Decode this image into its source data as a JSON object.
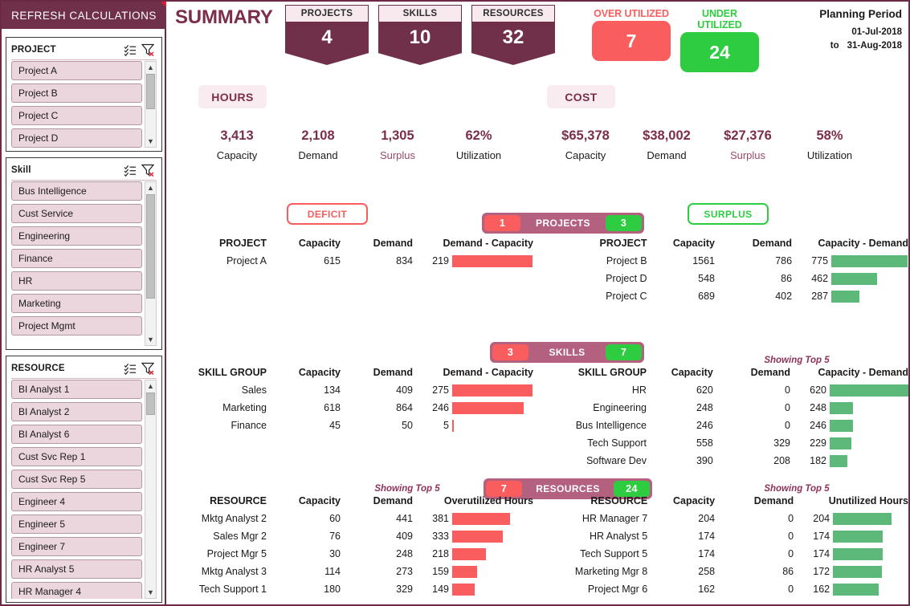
{
  "sidebar": {
    "refresh_label": "REFRESH CALCULATIONS",
    "slicers": [
      {
        "title": "PROJECT",
        "multiselect_icon": "multi-select-icon",
        "clear_filter_icon": "clear-filter-icon",
        "items": [
          "Project A",
          "Project B",
          "Project C",
          "Project D"
        ]
      },
      {
        "title": "Skill",
        "multiselect_icon": "multi-select-icon",
        "clear_filter_icon": "clear-filter-icon",
        "items": [
          "Bus Intelligence",
          "Cust Service",
          "Engineering",
          "Finance",
          "HR",
          "Marketing",
          "Project Mgmt"
        ]
      },
      {
        "title": "RESOURCE",
        "multiselect_icon": "multi-select-icon",
        "clear_filter_icon": "clear-filter-icon",
        "items": [
          "BI Analyst 1",
          "BI Analyst 2",
          "BI Analyst 6",
          "Cust Svc Rep 1",
          "Cust Svc Rep 5",
          "Engineer 4",
          "Engineer 5",
          "Engineer 7",
          "HR Analyst 5",
          "HR Manager 4"
        ]
      }
    ]
  },
  "header": {
    "title": "SUMMARY",
    "kpis": [
      {
        "label": "PROJECTS",
        "value": "4"
      },
      {
        "label": "SKILLS",
        "value": "10"
      },
      {
        "label": "RESOURCES",
        "value": "32"
      }
    ],
    "utilization_cards": [
      {
        "label": "OVER UTILIZED",
        "value": "7",
        "color": "#fa5d5d"
      },
      {
        "label": "UNDER UTILIZED",
        "value": "24",
        "color": "#2ecc40"
      }
    ],
    "planning_period": {
      "title": "Planning Period",
      "from": "01-Jul-2018",
      "to_label": "to",
      "to": "31-Aug-2018"
    }
  },
  "metrics": {
    "hours": {
      "tag": "HOURS",
      "items": [
        {
          "value": "3,413",
          "name": "Capacity",
          "accent": false
        },
        {
          "value": "2,108",
          "name": "Demand",
          "accent": false
        },
        {
          "value": "1,305",
          "name": "Surplus",
          "accent": true
        },
        {
          "value": "62%",
          "name": "Utilization",
          "accent": false
        }
      ]
    },
    "cost": {
      "tag": "COST",
      "items": [
        {
          "value": "$65,378",
          "name": "Capacity",
          "accent": false
        },
        {
          "value": "$38,002",
          "name": "Demand",
          "accent": false
        },
        {
          "value": "$27,376",
          "name": "Surplus",
          "accent": true
        },
        {
          "value": "58%",
          "name": "Utilization",
          "accent": false
        }
      ]
    }
  },
  "buttons": {
    "deficit": "DEFICIT",
    "surplus": "SURPLUS"
  },
  "showing_top": "Showing Top 5",
  "sections": {
    "projects": {
      "pill_label": "PROJECTS",
      "deficit_count": "1",
      "surplus_count": "3",
      "deficit_table": {
        "headers": [
          "PROJECT",
          "Capacity",
          "Demand",
          "Demand - Capacity"
        ],
        "rows": [
          {
            "name": "Project A",
            "capacity": "615",
            "demand": "834",
            "diff": "219",
            "bar_pct": 100
          }
        ]
      },
      "surplus_table": {
        "headers": [
          "PROJECT",
          "Capacity",
          "Demand",
          "Capacity - Demand"
        ],
        "rows": [
          {
            "name": "Project B",
            "capacity": "1561",
            "demand": "786",
            "diff": "775",
            "bar_pct": 100
          },
          {
            "name": "Project D",
            "capacity": "548",
            "demand": "86",
            "diff": "462",
            "bar_pct": 60
          },
          {
            "name": "Project C",
            "capacity": "689",
            "demand": "402",
            "diff": "287",
            "bar_pct": 37
          }
        ]
      }
    },
    "skills": {
      "pill_label": "SKILLS",
      "deficit_count": "3",
      "surplus_count": "7",
      "deficit_table": {
        "headers": [
          "SKILL GROUP",
          "Capacity",
          "Demand",
          "Demand - Capacity"
        ],
        "rows": [
          {
            "name": "Sales",
            "capacity": "134",
            "demand": "409",
            "diff": "275",
            "bar_pct": 100
          },
          {
            "name": "Marketing",
            "capacity": "618",
            "demand": "864",
            "diff": "246",
            "bar_pct": 89
          },
          {
            "name": "Finance",
            "capacity": "45",
            "demand": "50",
            "diff": "5",
            "bar_pct": 2
          }
        ]
      },
      "surplus_table": {
        "headers": [
          "SKILL GROUP",
          "Capacity",
          "Demand",
          "Capacity - Demand"
        ],
        "rows": [
          {
            "name": "HR",
            "capacity": "620",
            "demand": "0",
            "diff": "620",
            "bar_pct": 100
          },
          {
            "name": "Engineering",
            "capacity": "248",
            "demand": "0",
            "diff": "248",
            "bar_pct": 40
          },
          {
            "name": "Bus Intelligence",
            "capacity": "246",
            "demand": "0",
            "diff": "246",
            "bar_pct": 40
          },
          {
            "name": "Tech Support",
            "capacity": "558",
            "demand": "329",
            "diff": "229",
            "bar_pct": 37
          },
          {
            "name": "Software Dev",
            "capacity": "390",
            "demand": "208",
            "diff": "182",
            "bar_pct": 29
          }
        ]
      }
    },
    "resources": {
      "pill_label": "RESOURCES",
      "deficit_count": "7",
      "surplus_count": "24",
      "deficit_table": {
        "headers": [
          "RESOURCE",
          "Capacity",
          "Demand",
          "Overutilized Hours"
        ],
        "rows": [
          {
            "name": "Mktg Analyst 2",
            "capacity": "60",
            "demand": "441",
            "diff": "381",
            "bar_pct": 100
          },
          {
            "name": "Sales Mgr 2",
            "capacity": "76",
            "demand": "409",
            "diff": "333",
            "bar_pct": 87
          },
          {
            "name": "Project Mgr 5",
            "capacity": "30",
            "demand": "248",
            "diff": "218",
            "bar_pct": 57
          },
          {
            "name": "Mktg Analyst 3",
            "capacity": "114",
            "demand": "273",
            "diff": "159",
            "bar_pct": 42
          },
          {
            "name": "Tech Support 1",
            "capacity": "180",
            "demand": "329",
            "diff": "149",
            "bar_pct": 39
          }
        ]
      },
      "surplus_table": {
        "headers": [
          "RESOURCE",
          "Capacity",
          "Demand",
          "Unutilized Hours"
        ],
        "rows": [
          {
            "name": "HR Manager 7",
            "capacity": "204",
            "demand": "0",
            "diff": "204",
            "bar_pct": 100
          },
          {
            "name": "HR Analyst 5",
            "capacity": "174",
            "demand": "0",
            "diff": "174",
            "bar_pct": 85
          },
          {
            "name": "Tech Support 5",
            "capacity": "174",
            "demand": "0",
            "diff": "174",
            "bar_pct": 85
          },
          {
            "name": "Marketing Mgr 8",
            "capacity": "258",
            "demand": "86",
            "diff": "172",
            "bar_pct": 84
          },
          {
            "name": "Project Mgr 6",
            "capacity": "162",
            "demand": "0",
            "diff": "162",
            "bar_pct": 79
          }
        ]
      }
    }
  },
  "colors": {
    "brand": "#703049",
    "brand_light": "#b4607f",
    "deficit": "#fa5d5d",
    "surplus_badge": "#2ecc40",
    "surplus_bar": "#5cb97a",
    "slicer_item": "#ecd6de"
  }
}
